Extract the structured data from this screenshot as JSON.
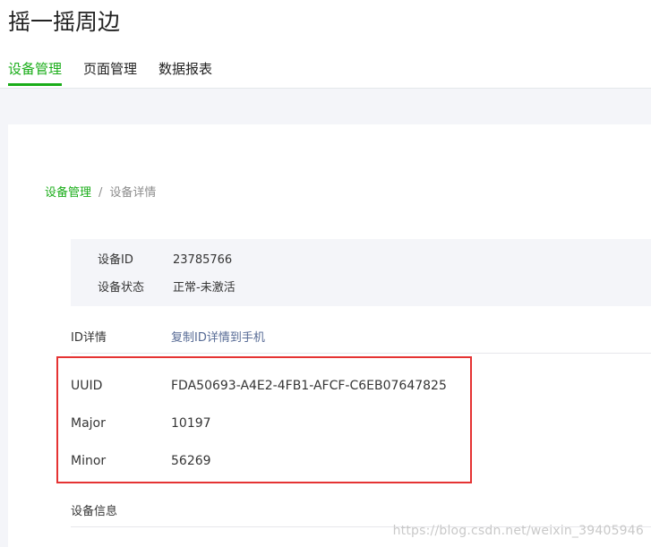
{
  "header": {
    "title": "摇一摇周边",
    "tabs": [
      {
        "label": "设备管理",
        "active": true
      },
      {
        "label": "页面管理",
        "active": false
      },
      {
        "label": "数据报表",
        "active": false
      }
    ]
  },
  "breadcrumb": {
    "parent": "设备管理",
    "separator": "/",
    "current": "设备详情"
  },
  "device_info": {
    "id_label": "设备ID",
    "id_value": "23785766",
    "status_label": "设备状态",
    "status_value": "正常-未激活"
  },
  "id_details": {
    "title": "ID详情",
    "copy_link": "复制ID详情到手机",
    "rows": [
      {
        "label": "UUID",
        "value": "FDA50693-A4E2-4FB1-AFCF-C6EB07647825"
      },
      {
        "label": "Major",
        "value": "10197"
      },
      {
        "label": "Minor",
        "value": "56269"
      }
    ]
  },
  "device_section": {
    "title": "设备信息"
  },
  "watermark": "https://blog.csdn.net/weixin_39405946",
  "colors": {
    "accent": "#1aad19",
    "link": "#576b95",
    "highlight": "#e53333"
  }
}
